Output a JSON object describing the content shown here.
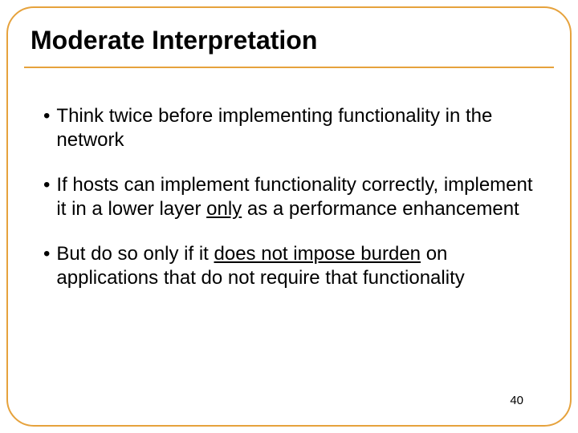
{
  "slide": {
    "title": "Moderate Interpretation",
    "page_number": "40",
    "bullets": [
      {
        "pre": "Think twice before implementing functionality in the network",
        "u": "",
        "post": ""
      },
      {
        "pre": "If hosts can implement functionality correctly, implement it in a lower layer ",
        "u": "only",
        "post": " as a performance enhancement"
      },
      {
        "pre": "But do so only if it ",
        "u": "does not impose burden",
        "post": " on applications that do not require that functionality"
      }
    ]
  }
}
